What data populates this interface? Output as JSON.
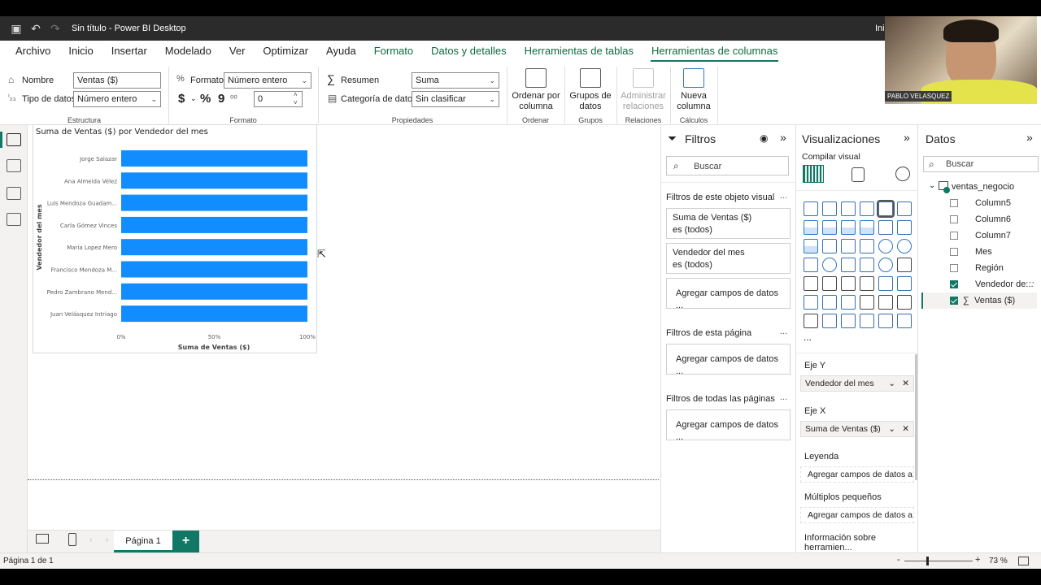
{
  "titlebar": {
    "title": "Sin título - Power BI Desktop",
    "right_text": "Inic"
  },
  "menu": [
    "Archivo",
    "Inicio",
    "Insertar",
    "Modelado",
    "Ver",
    "Optimizar",
    "Ayuda",
    "Formato",
    "Datos y detalles",
    "Herramientas de tablas",
    "Herramientas de columnas"
  ],
  "ribbon": {
    "estructura": {
      "nombre_label": "Nombre",
      "nombre_value": "Ventas ($)",
      "tipo_label": "Tipo de datos",
      "tipo_value": "Número entero",
      "group": "Estructura"
    },
    "formato": {
      "formato_label": "Formato",
      "formato_value": "Número entero",
      "decimals": "0",
      "currency": "$",
      "percent": "%",
      "comma": "9",
      "group": "Formato"
    },
    "propiedades": {
      "resumen_label": "Resumen",
      "resumen_value": "Suma",
      "categoria_label": "Categoría de datos",
      "categoria_value": "Sin clasificar",
      "group": "Propiedades"
    },
    "ordenar": {
      "label1": "Ordenar por",
      "label2": "columna",
      "group": "Ordenar"
    },
    "grupos": {
      "label1": "Grupos de",
      "label2": "datos",
      "group": "Grupos"
    },
    "relaciones": {
      "label1": "Administrar",
      "label2": "relaciones",
      "group": "Relaciones"
    },
    "calculos": {
      "label1": "Nueva",
      "label2": "columna",
      "group": "Cálculos"
    }
  },
  "chart_data": {
    "type": "bar",
    "title": "Suma de Ventas ($) por Vendedor del mes",
    "xlabel": "Suma de Ventas ($)",
    "ylabel": "Vendedor del mes",
    "categories": [
      "Jorge Salazar",
      "Ana Almeida Vélez",
      "Luis Mendoza Guadam...",
      "Carla Gómez Vinces",
      "María Lopez Mero",
      "Francisco Mendoza M...",
      "Pedro Zambrano Mend...",
      "Juan Velásquez Intriago"
    ],
    "values": [
      100,
      100,
      100,
      100,
      100,
      100,
      100,
      100
    ],
    "xticks": [
      "0%",
      "50%",
      "100%"
    ],
    "xlim": [
      0,
      100
    ],
    "color": "#118dff"
  },
  "pages": {
    "tab": "Página 1",
    "add": "+"
  },
  "status": {
    "page": "Página 1 de 1",
    "zoom": "73 %",
    "minus": "-",
    "plus": "+"
  },
  "filters": {
    "title": "Filtros",
    "search": "Buscar",
    "visual_section": "Filtros de este objeto visual",
    "card1_title": "Suma de Ventas ($)",
    "card1_sub": "es (todos)",
    "card2_title": "Vendedor del mes",
    "card2_sub": "es (todos)",
    "add": "Agregar campos de datos ...",
    "page_section": "Filtros de esta página",
    "all_section": "Filtros de todas las páginas",
    "dots": "..."
  },
  "viz": {
    "title": "Visualizaciones",
    "subtitle": "Compilar visual",
    "more": "...",
    "eje_y": "Eje Y",
    "eje_y_value": "Vendedor del mes",
    "eje_x": "Eje X",
    "eje_x_value": "Suma de Ventas ($)",
    "leyenda": "Leyenda",
    "add": "Agregar campos de datos a...",
    "multiples": "Múltiplos pequeños",
    "info": "Información sobre herramien..."
  },
  "data": {
    "title": "Datos",
    "search": "Buscar",
    "table": "ventas_negocio",
    "fields": [
      {
        "name": "Column5",
        "checked": false
      },
      {
        "name": "Column6",
        "checked": false
      },
      {
        "name": "Column7",
        "checked": false
      },
      {
        "name": "Mes",
        "checked": false
      },
      {
        "name": "Región",
        "checked": false
      },
      {
        "name": "Vendedor de...",
        "checked": true
      },
      {
        "name": "Ventas ($)",
        "checked": true
      }
    ],
    "sigma": "∑",
    "field_more": "···"
  },
  "webcam": {
    "name": "PABLO VELASQUEZ"
  }
}
